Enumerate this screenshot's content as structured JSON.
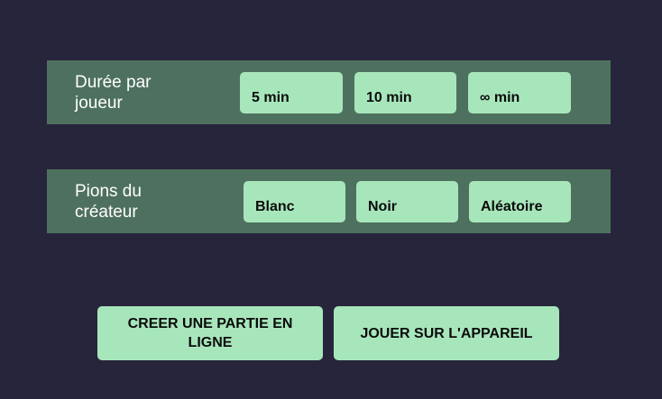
{
  "duration": {
    "label": "Durée par joueur",
    "options": [
      "5 min",
      "10 min",
      "∞ min"
    ]
  },
  "color": {
    "label": "Pions du créateur",
    "options": [
      "Blanc",
      "Noir",
      "Aléatoire"
    ]
  },
  "actions": {
    "create_online": "CREER UNE PARTIE EN LIGNE",
    "play_local": "JOUER SUR L'APPAREIL"
  },
  "colors": {
    "background": "#27253b",
    "panel": "#4e715f",
    "button": "#a7e6bb",
    "button_text": "#0b0b0b",
    "label_text": "#ffffff"
  }
}
